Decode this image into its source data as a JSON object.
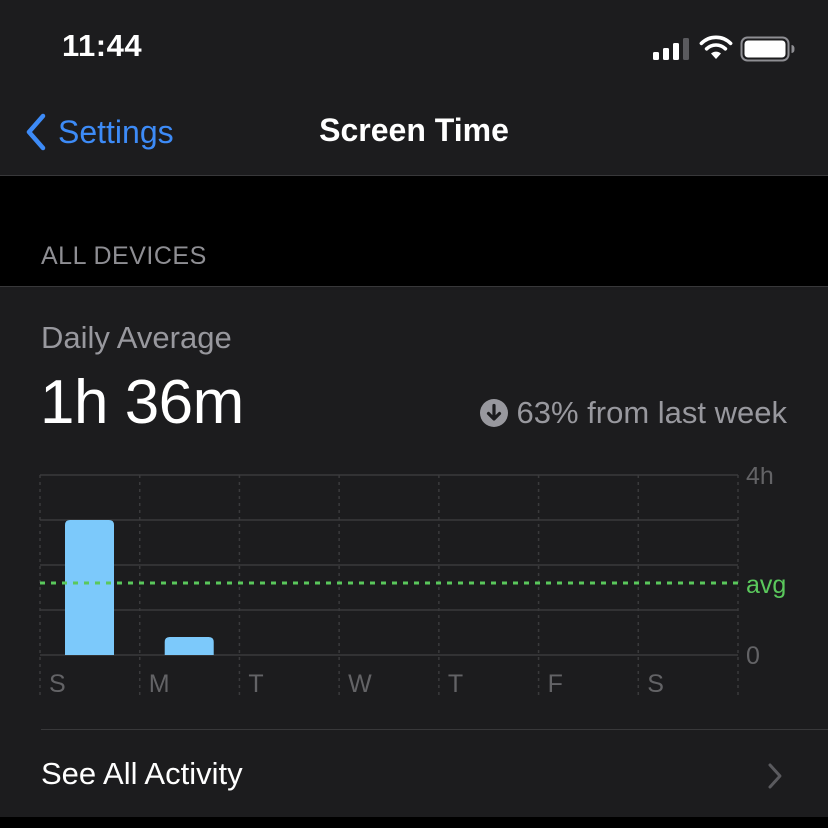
{
  "status_bar": {
    "time": "11:44",
    "icons": [
      "cellular-signal-icon",
      "wifi-icon",
      "battery-icon"
    ]
  },
  "nav": {
    "back_label": "Settings",
    "back_icon": "chevron-left-icon",
    "title": "Screen Time"
  },
  "section_header": "ALL DEVICES",
  "summary": {
    "label": "Daily Average",
    "value": "1h 36m",
    "change_icon": "arrow-down-circle-icon",
    "change_text": "63% from last week"
  },
  "chart_data": {
    "type": "bar",
    "categories": [
      "S",
      "M",
      "T",
      "W",
      "T",
      "F",
      "S"
    ],
    "values": [
      3.0,
      0.4,
      0,
      0,
      0,
      0,
      0
    ],
    "ylim": [
      0,
      4
    ],
    "y_tick_labels": [
      "4h",
      "0"
    ],
    "average_line": {
      "label": "avg",
      "value": 1.6
    },
    "grid": true,
    "bar_color": "#7cc9fb",
    "avg_color": "#5ac85c"
  },
  "actions": {
    "see_all_label": "See All Activity",
    "see_all_icon": "chevron-right-icon"
  },
  "colors": {
    "accent": "#3d8bf7",
    "background": "#000000",
    "card": "#1c1c1e",
    "secondary_text": "#98989e"
  }
}
